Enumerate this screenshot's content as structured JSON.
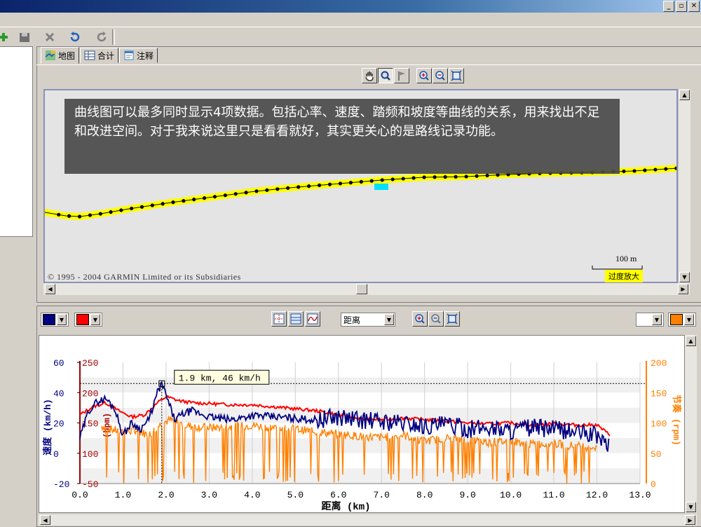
{
  "window": {
    "buttons": [
      "_",
      "▫",
      "✕"
    ]
  },
  "toolbar": {
    "icons": [
      "add-icon",
      "save-icon",
      "delete-icon",
      "undo-icon",
      "redo-icon"
    ]
  },
  "tabs": [
    {
      "label": "地图",
      "icon": "map-icon",
      "active": true
    },
    {
      "label": "合计",
      "icon": "table-icon",
      "active": false
    },
    {
      "label": "注释",
      "icon": "notes-icon",
      "active": false
    }
  ],
  "map": {
    "tools": [
      "hand-tool-icon",
      "zoom-tool-icon",
      "flag-tool-icon",
      "zoom-in-icon",
      "zoom-out-icon",
      "zoom-fit-icon"
    ],
    "overlay_text": "曲线图可以最多同时显示4项数据。包括心率、速度、踏频和坡度等曲线的关系，用来找出不足和改进空间。对于我来说这里只是看看就好，其实更关心的是路线记录功能。",
    "copyright": "© 1995 - 2004 GARMIN Limited or its Subsidiaries",
    "scale_label": "100 m",
    "zoom_label": "过度放大",
    "track_color": "#ffff00",
    "highlight_color": "#00e0ff"
  },
  "chart_panel": {
    "left_colors": [
      "#000080",
      "#ff0000"
    ],
    "right_colors": [
      "#ffffff",
      "#ff8000"
    ],
    "x_axis_select": "距离",
    "tools": [
      "crosshair-icon",
      "grid-icon",
      "curve-icon",
      "zoom-in-icon",
      "zoom-out-icon",
      "zoom-fit-icon"
    ]
  },
  "chart_data": {
    "type": "line",
    "xlabel": "距离 (km)",
    "x_ticks": [
      "0.0",
      "1.0",
      "2.0",
      "3.0",
      "4.0",
      "5.0",
      "6.0",
      "7.0",
      "8.0",
      "9.0",
      "10.0",
      "11.0",
      "12.0",
      "13.0"
    ],
    "xlim": [
      0,
      13
    ],
    "left_axis_1": {
      "label": "速度 (km/h)",
      "ticks": [
        "60",
        "40",
        "20",
        "0",
        "-20"
      ],
      "range": [
        -20,
        60
      ],
      "color": "#000080"
    },
    "left_axis_2": {
      "label": "(bpm)",
      "ticks": [
        "250",
        "200",
        "150",
        "100",
        "-50"
      ],
      "range": [
        -50,
        250
      ],
      "color": "#a00000"
    },
    "right_axis": {
      "label": "节奏 (rpm)",
      "ticks": [
        "200",
        "150",
        "100",
        "50",
        "0"
      ],
      "range": [
        0,
        200
      ],
      "color": "#ff8000"
    },
    "tooltip": "1.9 km, 46 km/h",
    "tooltip_point": {
      "x": 1.9,
      "y": 46
    },
    "series": [
      {
        "name": "速度",
        "color": "#000080",
        "x": [
          0,
          0.2,
          0.4,
          0.6,
          0.8,
          1.0,
          1.2,
          1.4,
          1.6,
          1.8,
          1.9,
          2.0,
          2.2,
          2.4,
          2.6,
          3.0,
          3.5,
          4.0,
          4.5,
          5.0,
          5.5,
          6.0,
          6.5,
          7.0,
          7.5,
          8.0,
          8.5,
          9.0,
          9.5,
          10.0,
          10.5,
          11.0,
          11.5,
          12.0,
          12.3
        ],
        "y": [
          10,
          28,
          34,
          36,
          30,
          12,
          20,
          16,
          22,
          40,
          46,
          38,
          22,
          26,
          28,
          24,
          22,
          25,
          24,
          23,
          22,
          24,
          22,
          21,
          20,
          18,
          19,
          16,
          17,
          15,
          17,
          16,
          14,
          12,
          4
        ]
      },
      {
        "name": "心率",
        "color": "#ff0000",
        "x": [
          0,
          0.3,
          0.6,
          0.9,
          1.2,
          1.5,
          1.8,
          2.0,
          2.3,
          2.6,
          3.0,
          3.5,
          4.0,
          4.5,
          5.0,
          5.5,
          6.0,
          6.5,
          7.0,
          7.5,
          8.0,
          8.5,
          9.0,
          9.5,
          10.0,
          10.5,
          11.0,
          11.5,
          12.0,
          12.3
        ],
        "y": [
          120,
          140,
          150,
          130,
          115,
          120,
          150,
          165,
          155,
          150,
          148,
          145,
          145,
          140,
          135,
          130,
          120,
          110,
          108,
          112,
          108,
          105,
          100,
          98,
          100,
          95,
          98,
          95,
          95,
          70
        ]
      },
      {
        "name": "节奏",
        "color": "#ff8000",
        "x": [
          0.5,
          0.7,
          1.0,
          1.3,
          1.6,
          1.9,
          2.1,
          2.5,
          3.0,
          3.5,
          4.0,
          4.5,
          5.0,
          5.5,
          6.0,
          6.5,
          7.0,
          7.5,
          8.0,
          8.5,
          9.0,
          9.5,
          10.0,
          10.5,
          11.0,
          11.5,
          12.0
        ],
        "y": [
          95,
          90,
          85,
          88,
          80,
          100,
          105,
          95,
          92,
          94,
          96,
          92,
          90,
          85,
          82,
          78,
          76,
          80,
          70,
          75,
          72,
          68,
          70,
          65,
          66,
          62,
          60
        ]
      }
    ]
  }
}
